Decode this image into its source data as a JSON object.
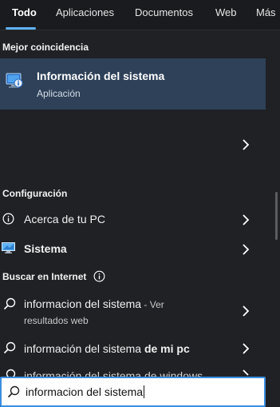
{
  "tabs": [
    {
      "label": "Todo",
      "active": true
    },
    {
      "label": "Aplicaciones",
      "active": false
    },
    {
      "label": "Documentos",
      "active": false
    },
    {
      "label": "Web",
      "active": false
    },
    {
      "label": "Más",
      "active": false
    }
  ],
  "best_match": {
    "heading": "Mejor coincidencia",
    "title": "Información del sistema",
    "subtitle": "Aplicación",
    "icon": "system-information-icon"
  },
  "settings": {
    "heading": "Configuración",
    "items": [
      {
        "label": "Acerca de tu PC",
        "icon": "info-icon"
      },
      {
        "label": "Sistema",
        "icon": "monitor-icon"
      }
    ]
  },
  "web": {
    "heading": "Buscar en Internet",
    "items": [
      {
        "query": "informacion del sistema",
        "suffix": " - Ver",
        "sub": "resultados web"
      },
      {
        "query_plain": "información del sistema ",
        "query_bold": "de mi pc"
      },
      {
        "partial": "información del sistema de windows"
      }
    ]
  },
  "search": {
    "value": "informacion del sistema"
  },
  "colors": {
    "accent": "#5fb2f2",
    "selected_bg": "#2e4159",
    "search_border": "#3b8ee0"
  }
}
